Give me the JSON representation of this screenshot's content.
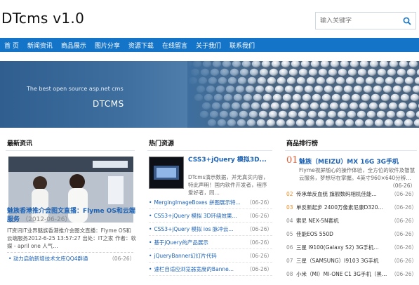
{
  "site": {
    "title": "DTcms v1.0"
  },
  "search": {
    "placeholder": "输入关键字"
  },
  "nav": [
    "首 页",
    "新闻资讯",
    "商品展示",
    "图片分享",
    "资源下载",
    "在线留言",
    "关于我们",
    "联系我们"
  ],
  "banner": {
    "subtitle": "The best open source asp.net cms",
    "title": "DTCMS"
  },
  "latest": {
    "heading": "最新资讯",
    "headline": "魅族香港推介会图文直播：Flyme OS和云端服务",
    "headline_date": "（2012-06-26）",
    "desc": "IT资讯IT业界魅族香港推介会图文直播：Flyme OS和云端服务2012-6-25 13:57:27 出处：IT之家 作者：软媒 - april one 人气…",
    "item": "动力启航新增技术文库QQ4群通",
    "item_date": "（06-26）"
  },
  "hot": {
    "heading": "热门资源",
    "top_title": "CSS3+jQuery 模拟3D...",
    "top_desc": "DTcms演示数据，并无真实内容，特此声明！国内软件开发者，程序爱好者，同…",
    "items": [
      {
        "title": "MergingImageBoxes 拼图展示特...",
        "date": "（06-26）"
      },
      {
        "title": "CSS3+jQuery 模拟 3D环绕效果...",
        "date": "（06-26）"
      },
      {
        "title": "CSS3+jQuery 模拟 ios 脉冲云...",
        "date": "（06-26）"
      },
      {
        "title": "基于jQuery的产品展示",
        "date": "（06-26）"
      },
      {
        "title": "jQueryBanner幻灯片代码",
        "date": "（06-26）"
      },
      {
        "title": "速栏自适应浏览器宽度的Banne...",
        "date": "（06-26）"
      }
    ]
  },
  "ranking": {
    "heading": "商品排行榜",
    "top_num": "01",
    "top_title": "魅族（MEIZU）MX 16G 3G手机",
    "top_desc": "Flyme视屏随心的操作体验，全方位的软件及智慧云服务，梦想尽在掌握。4英寸960×640分辨…",
    "top_date": "（06-26）",
    "items": [
      {
        "num": "02",
        "title": "传承单反血统 旗舰数码相机佳能…",
        "date": "（06-26）"
      },
      {
        "num": "03",
        "title": "单反新起步 2400万像素尼康D320…",
        "date": "（06-26）"
      },
      {
        "num": "04",
        "title": "索尼 NEX-5N套机",
        "date": "（06-26）"
      },
      {
        "num": "05",
        "title": "佳能EOS 550D",
        "date": "（06-26）"
      },
      {
        "num": "06",
        "title": "三星 I9100(Galaxy S2) 3G手机…",
        "date": "（06-26）"
      },
      {
        "num": "07",
        "title": "三星（SAMSUNG）I9103 3G手机",
        "date": "（06-26）"
      },
      {
        "num": "08",
        "title": "小米（MI）MI-ONE C1 3G手机（黑…",
        "date": "（06-26）"
      }
    ]
  }
}
